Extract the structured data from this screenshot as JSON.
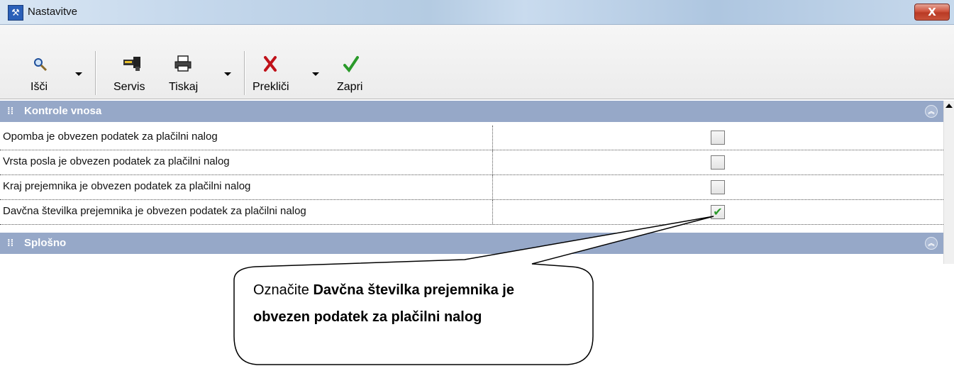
{
  "window": {
    "title": "Nastavitve",
    "close_label": "X",
    "app_icon": "wrench-people-icon"
  },
  "toolbar": {
    "search_label": "Išči",
    "service_label": "Servis",
    "print_label": "Tiskaj",
    "cancel_label": "Prekliči",
    "close_label": "Zapri"
  },
  "sections": [
    {
      "label": "Kontrole vnosa",
      "collapse_icon": "chevron-up-double-icon"
    },
    {
      "label": "Splošno",
      "collapse_icon": "chevron-up-double-icon"
    }
  ],
  "rows": [
    {
      "label": "Opomba je obvezen podatek za plačilni nalog",
      "checked": false
    },
    {
      "label": "Vrsta posla je obvezen podatek za plačilni nalog",
      "checked": false
    },
    {
      "label": "Kraj prejemnika je obvezen podatek za plačilni nalog",
      "checked": false
    },
    {
      "label": "Davčna številka prejemnika je obvezen podatek za plačilni nalog",
      "checked": true
    }
  ],
  "callout": {
    "prefix": "Označite ",
    "bold": "Davčna številka prejemnika je obvezen podatek za plačilni nalog"
  },
  "colors": {
    "section_header": "#96a8c8",
    "check_mark": "#2a9a2a",
    "cancel_red": "#c0121a",
    "ok_green": "#2a9a2a"
  }
}
